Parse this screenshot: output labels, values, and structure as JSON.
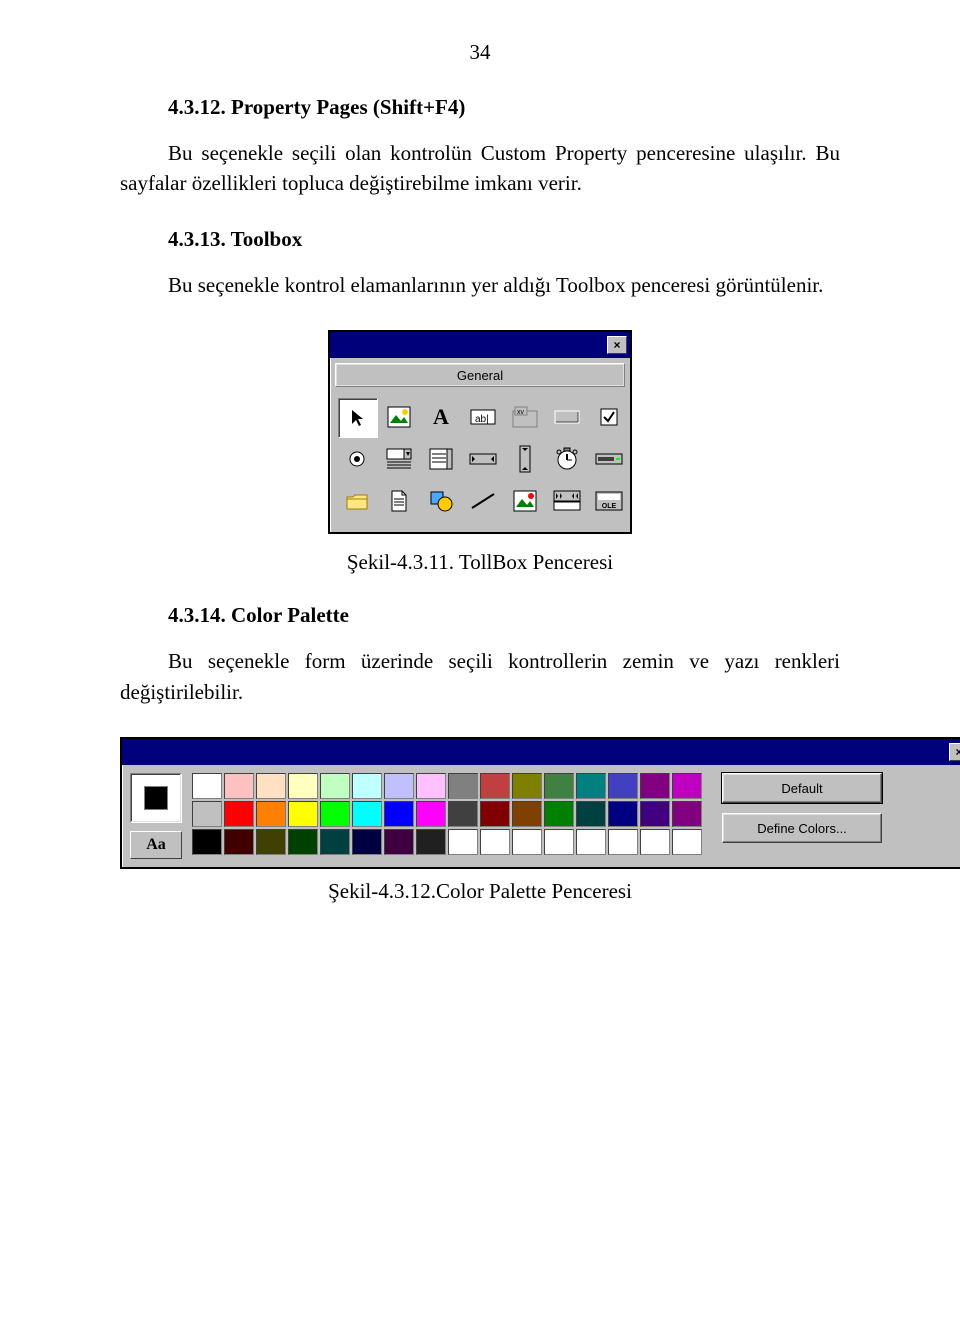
{
  "page_number": "34",
  "sections": {
    "s1": {
      "heading": "4.3.12. Property Pages (Shift+F4)",
      "para": "Bu seçenekle seçili olan kontrolün Custom Property penceresine ulaşılır. Bu sayfalar özellikleri topluca değiştirebilme imkanı verir."
    },
    "s2": {
      "heading": "4.3.13. Toolbox",
      "para": "Bu seçenekle kontrol elamanlarının yer aldığı Toolbox penceresi görüntülenir."
    },
    "toolbox": {
      "general_label": "General",
      "close_glyph": "×"
    },
    "caption1": "Şekil-4.3.11. TollBox Penceresi",
    "s3": {
      "heading": "4.3.14. Color Palette",
      "para": "Bu seçenekle form üzerinde seçili kontrollerin zemin ve yazı renkleri değiştirilebilir."
    },
    "palette": {
      "close_glyph": "×",
      "aa_label": "Aa",
      "default_button": "Default",
      "define_button": "Define Colors...",
      "row1": [
        "#ffffff",
        "#ffc0c0",
        "#ffe0c0",
        "#ffffc0",
        "#c0ffc0",
        "#c0ffff",
        "#c0c0ff",
        "#ffc0ff",
        "#808080",
        "#c04040",
        "#808000",
        "#408040",
        "#008080",
        "#4040c0",
        "#800080",
        "#c000c0"
      ],
      "row2": [
        "#c0c0c0",
        "#ff0000",
        "#ff8000",
        "#ffff00",
        "#00ff00",
        "#00ffff",
        "#0000ff",
        "#ff00ff",
        "#404040",
        "#800000",
        "#804000",
        "#008000",
        "#004040",
        "#000080",
        "#400080",
        "#800080"
      ],
      "row3": [
        "#000000",
        "#400000",
        "#404000",
        "#004000",
        "#004040",
        "#000040",
        "#400040",
        "#202020",
        "#ffffff",
        "#ffffff",
        "#ffffff",
        "#ffffff",
        "#ffffff",
        "#ffffff",
        "#ffffff",
        "#ffffff"
      ]
    },
    "caption2": "Şekil-4.3.12.Color Palette Penceresi"
  }
}
